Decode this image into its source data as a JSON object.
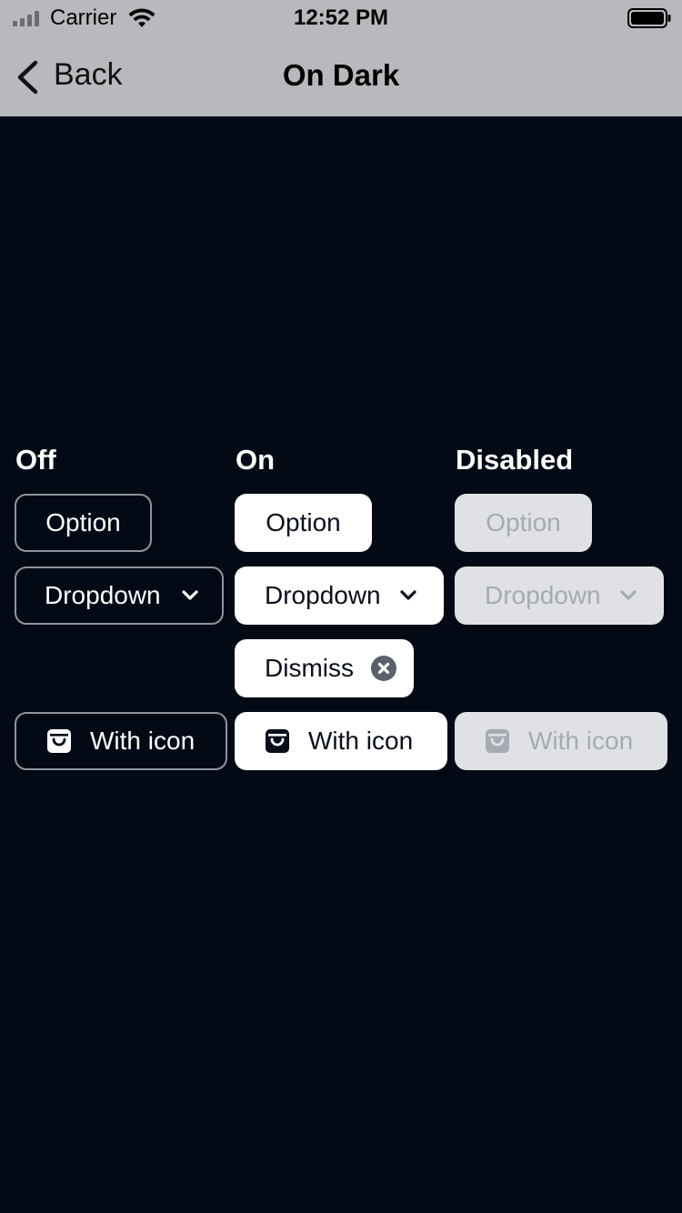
{
  "status_bar": {
    "carrier": "Carrier",
    "time": "12:52 PM"
  },
  "nav": {
    "back_label": "Back",
    "title": "On Dark"
  },
  "columns": {
    "off": "Off",
    "on": "On",
    "disabled": "Disabled"
  },
  "chips": {
    "off": {
      "option": "Option",
      "dropdown": "Dropdown",
      "with_icon": "With icon"
    },
    "on": {
      "option": "Option",
      "dropdown": "Dropdown",
      "dismiss": "Dismiss",
      "with_icon": "With icon"
    },
    "disabled": {
      "option": "Option",
      "dropdown": "Dropdown",
      "with_icon": "With icon"
    }
  },
  "icons": {
    "chip_icon": "bag-icon",
    "dropdown": "chevron-down-icon",
    "dismiss": "close-circle-icon"
  },
  "colors": {
    "background": "#030a15",
    "bar": "#b8b9bd",
    "on_chip": "#ffffff",
    "disabled_chip": "#dfe1e5",
    "disabled_text": "#a6aab2",
    "off_border": "#8f939b"
  }
}
